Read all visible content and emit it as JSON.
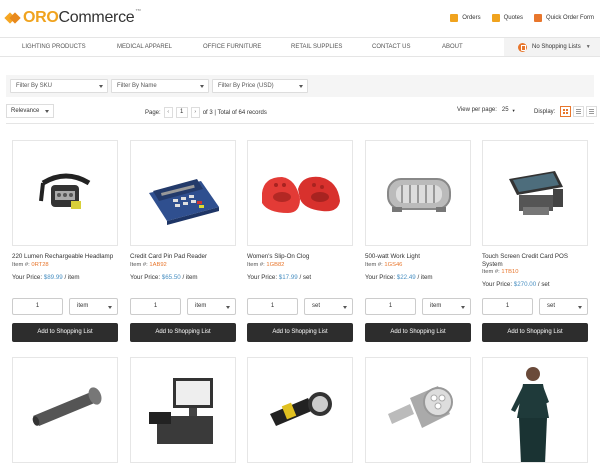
{
  "header": {
    "logo_oro": "ORO",
    "logo_commerce": "Commerce",
    "logo_tm": "™",
    "links": [
      {
        "label": "Orders",
        "icon": "orders-icon",
        "color": "#f0a31e"
      },
      {
        "label": "Quotes",
        "icon": "quotes-icon",
        "color": "#f0a31e"
      },
      {
        "label": "Quick Order Form",
        "icon": "quick-order-icon",
        "color": "#e8762c"
      }
    ]
  },
  "nav": {
    "items": [
      "LIGHTING PRODUCTS",
      "MEDICAL APPAREL",
      "OFFICE FURNITURE",
      "RETAIL SUPPLIES",
      "CONTACT US",
      "ABOUT"
    ],
    "shopping_lists": "No Shopping Lists",
    "shopping_lists_icon": "shopping-list-icon"
  },
  "filters": [
    "Filter By SKU",
    "Filter By Name",
    "Filter By Price (USD)"
  ],
  "toolbar": {
    "sort": "Relevance",
    "page_label": "Page:",
    "prev": "‹",
    "page_value": "1",
    "next": "›",
    "page_info": "of 3 | Total of 64 records",
    "per_page_label": "View per page:",
    "per_page_value": "25",
    "display_label": "Display:"
  },
  "accent_color": "#e8762c",
  "products": [
    {
      "name": "220 Lumen Rechargeable Headlamp",
      "item_label": "Item #:",
      "sku": "0RT28",
      "price_label": "Your Price:",
      "price": "$89.99",
      "unit_suffix": "/ item",
      "qty": "1",
      "unit": "item",
      "button": "Add to Shopping List"
    },
    {
      "name": "Credit Card Pin Pad Reader",
      "item_label": "Item #:",
      "sku": "1AB92",
      "price_label": "Your Price:",
      "price": "$65.50",
      "unit_suffix": "/ item",
      "qty": "1",
      "unit": "item",
      "button": "Add to Shopping List"
    },
    {
      "name": "Women's Slip-On Clog",
      "item_label": "Item #:",
      "sku": "1GB82",
      "price_label": "Your Price:",
      "price": "$17.99",
      "unit_suffix": "/ set",
      "qty": "1",
      "unit": "set",
      "button": "Add to Shopping List"
    },
    {
      "name": "500-watt Work Light",
      "item_label": "Item #:",
      "sku": "1GS46",
      "price_label": "Your Price:",
      "price": "$22.49",
      "unit_suffix": "/ item",
      "qty": "1",
      "unit": "item",
      "button": "Add to Shopping List"
    },
    {
      "name": "Touch Screen Credit Card POS System",
      "item_label": "Item #:",
      "sku": "1TB10",
      "price_label": "Your Price:",
      "price": "$270.00",
      "unit_suffix": "/ set",
      "qty": "1",
      "unit": "set",
      "button": "Add to Shopping List"
    }
  ],
  "second_row_images": [
    "flashlight-image",
    "pos-register-image",
    "work-light-image",
    "led-bulb-image",
    "scrubs-model-image"
  ]
}
